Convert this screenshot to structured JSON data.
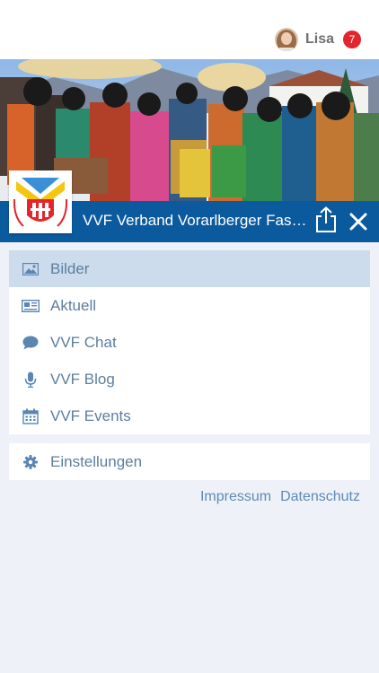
{
  "user": {
    "name": "Lisa",
    "notification_count": "7"
  },
  "club": {
    "name": "VVF Verband Vorarlberger Faschingsgilden"
  },
  "menu": {
    "items": [
      {
        "label": "Bilder",
        "icon": "image-icon",
        "active": true
      },
      {
        "label": "Aktuell",
        "icon": "newspaper-icon",
        "active": false
      },
      {
        "label": "VVF Chat",
        "icon": "chat-icon",
        "active": false
      },
      {
        "label": "VVF Blog",
        "icon": "microphone-icon",
        "active": false
      },
      {
        "label": "VVF Events",
        "icon": "calendar-icon",
        "active": false
      }
    ],
    "settings_label": "Einstellungen"
  },
  "footer": {
    "impressum": "Impressum",
    "datenschutz": "Datenschutz"
  },
  "colors": {
    "header_blue": "#0c5a9e",
    "menu_text": "#5b7f9e",
    "active_row": "#cddcec",
    "link": "#5f89b4",
    "badge": "#e2262c",
    "background": "#eef2f8"
  }
}
